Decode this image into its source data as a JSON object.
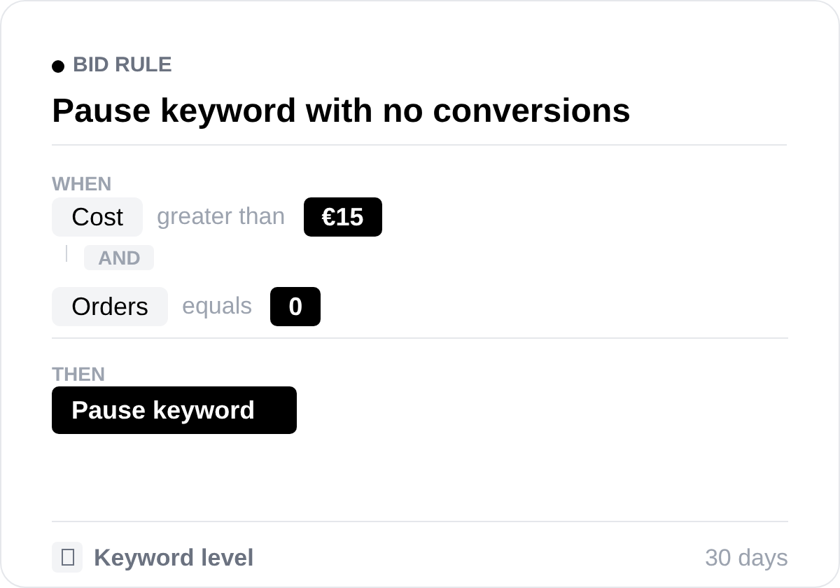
{
  "card": {
    "eyebrow": "BID RULE",
    "title": "Pause keyword with no conversions"
  },
  "when": {
    "label": "WHEN",
    "conditions": [
      {
        "field": "Cost",
        "operator": "greater than",
        "value": "€15"
      },
      {
        "field": "Orders",
        "operator": "equals",
        "value": "0"
      }
    ],
    "connector": "AND"
  },
  "then": {
    "label": "THEN",
    "action": "Pause keyword"
  },
  "footer": {
    "scope": "Keyword level",
    "window": "30 days"
  }
}
